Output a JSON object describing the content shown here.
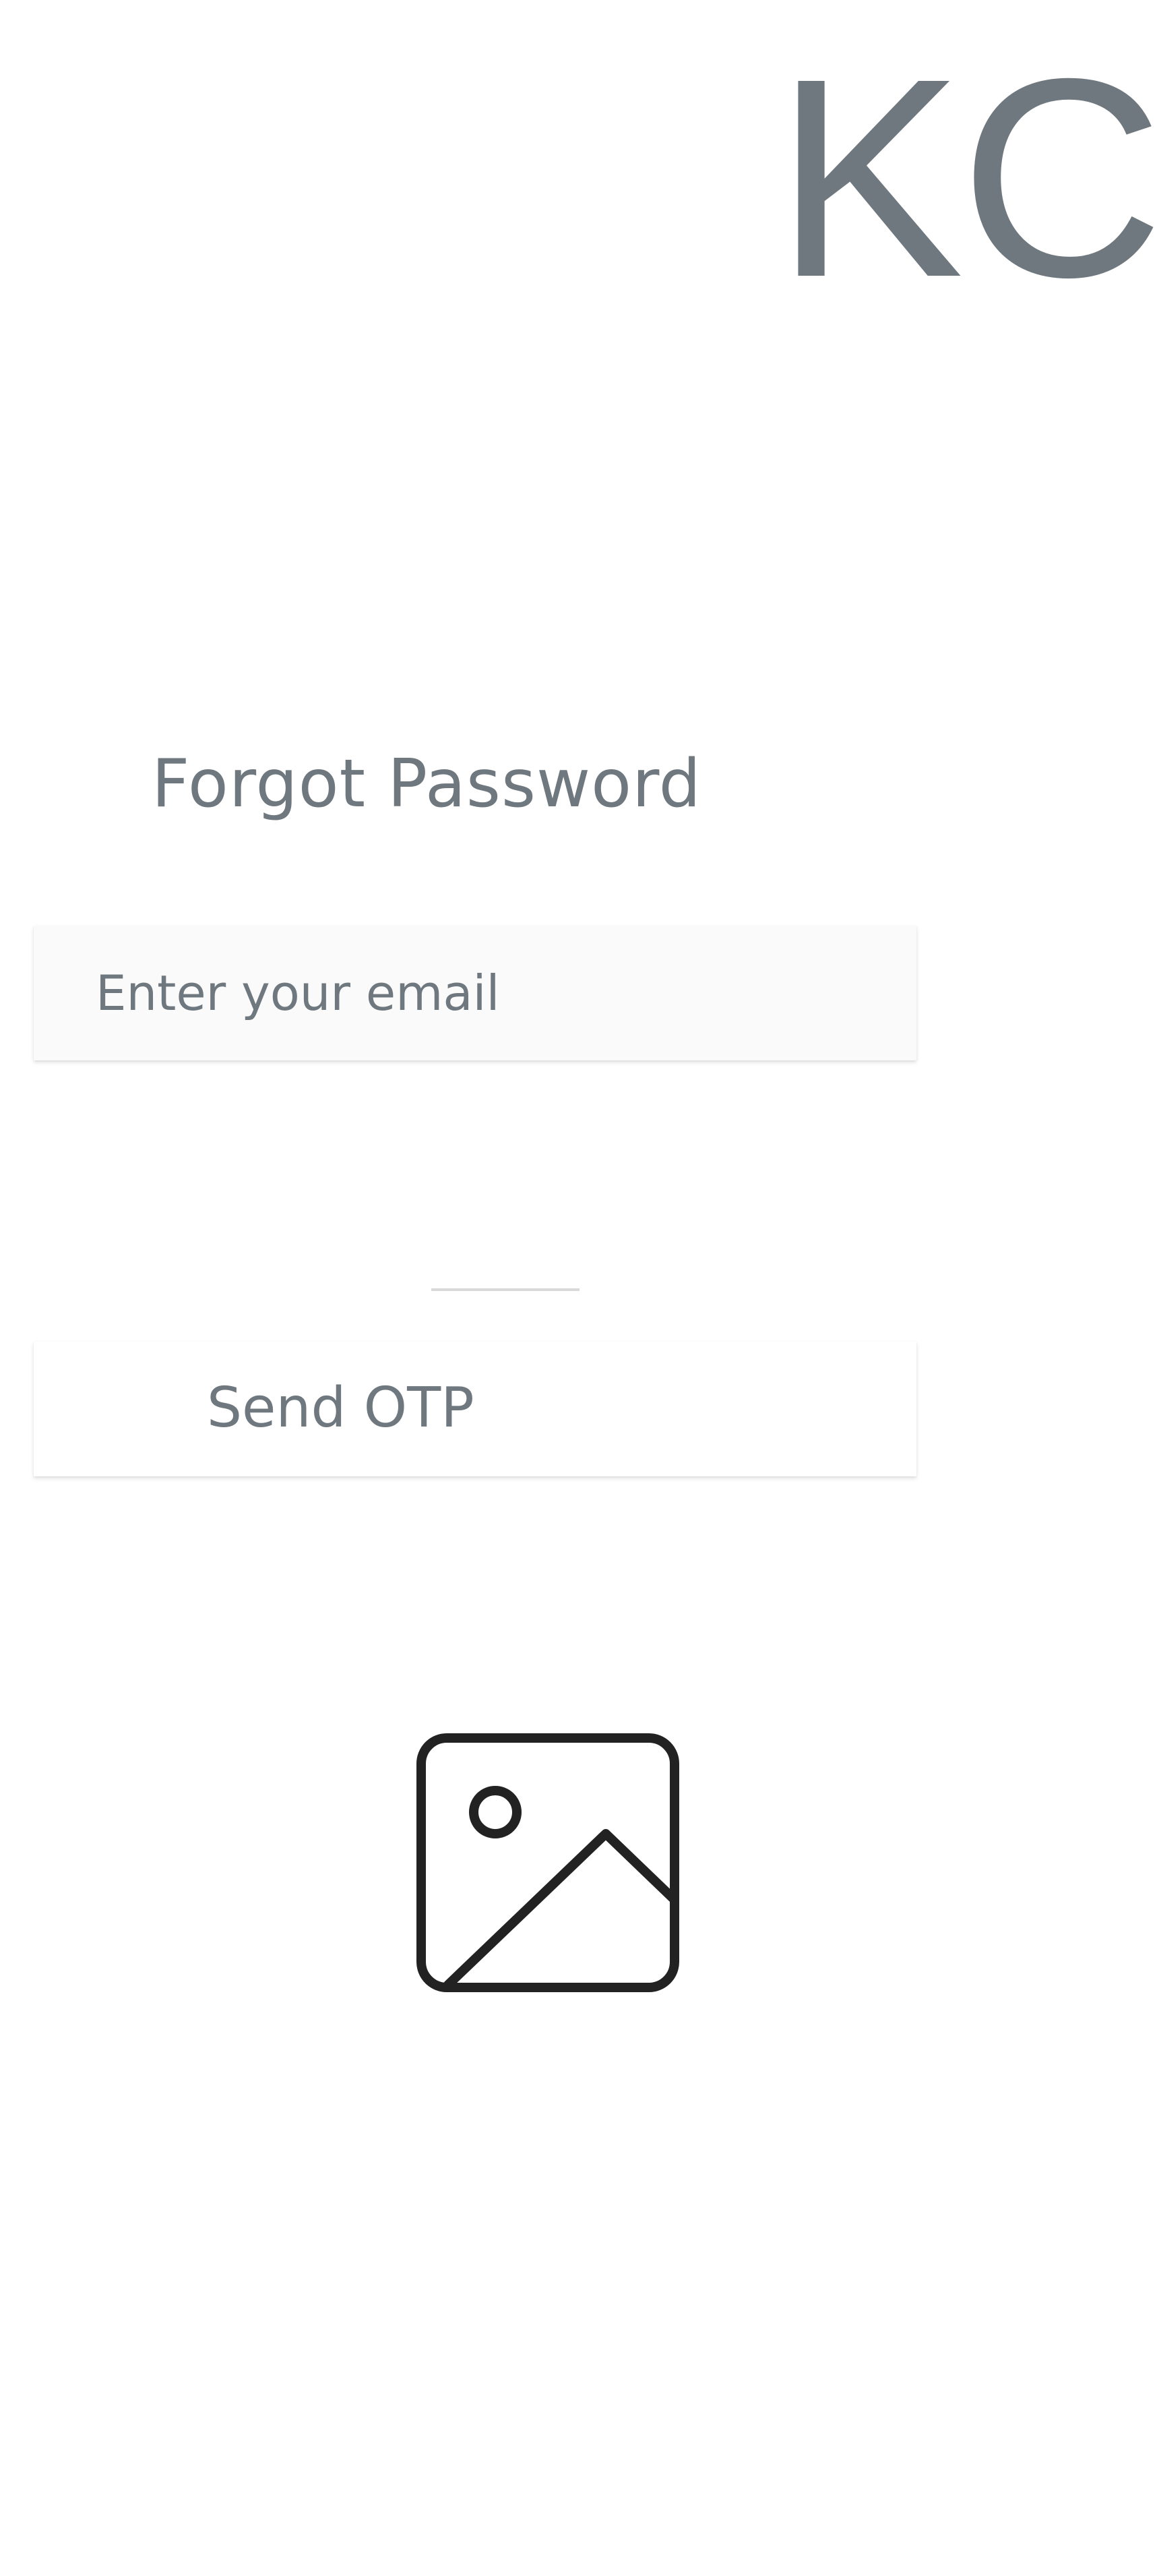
{
  "app": {
    "logo_text": "KC"
  },
  "form": {
    "title": "Forgot Password",
    "email_placeholder": "Enter your email",
    "email_value": "",
    "submit_label": "Send OTP"
  },
  "media": {
    "icon": "image-placeholder-icon"
  },
  "colors": {
    "text": "#6e787e",
    "field_background": "#fafafa",
    "divider": "#d9d9d9",
    "icon_stroke": "#222222"
  }
}
